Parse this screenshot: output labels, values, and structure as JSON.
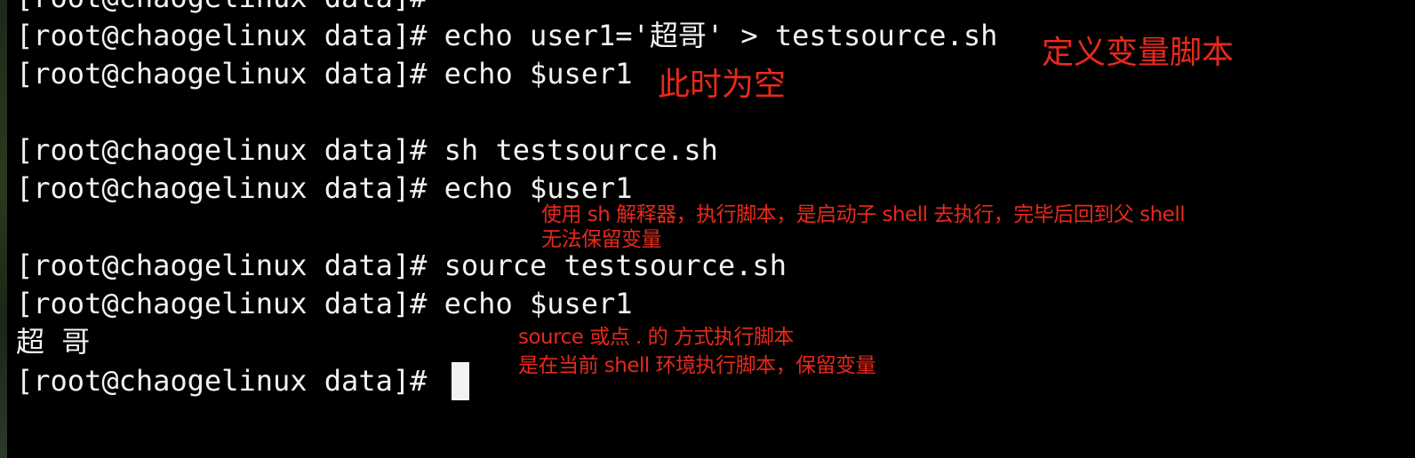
{
  "terminal": {
    "lines": [
      {
        "prompt": "[root@chaogelinux data]#",
        "command": ""
      },
      {
        "prompt": "[root@chaogelinux data]#",
        "command": "echo user1='超哥' > testsource.sh"
      },
      {
        "prompt": "[root@chaogelinux data]#",
        "command": "echo $user1"
      },
      {
        "prompt": "[root@chaogelinux data]#",
        "command": "sh testsource.sh"
      },
      {
        "prompt": "[root@chaogelinux data]#",
        "command": "echo $user1"
      },
      {
        "prompt": "[root@chaogelinux data]#",
        "command": "source testsource.sh"
      },
      {
        "prompt": "[root@chaogelinux data]#",
        "command": "echo $user1"
      },
      {
        "prompt": "[root@chaogelinux data]#",
        "command": ""
      }
    ],
    "output_user1": "超 哥"
  },
  "annotations": {
    "define_script": "定义变量脚本",
    "empty_now": "此时为空",
    "sh_note_1": "使用 sh 解释器，执行脚本，是启动子 shell 去执行，完毕后回到父 shell",
    "sh_note_2": "无法保留变量",
    "source_note_1": "source 或点 . 的 方式执行脚本",
    "source_note_2": "是在当前 shell 环境执行脚本，保留变量"
  },
  "colors": {
    "background": "#000000",
    "text": "#f2f2f2",
    "annotation": "#e8291c"
  }
}
